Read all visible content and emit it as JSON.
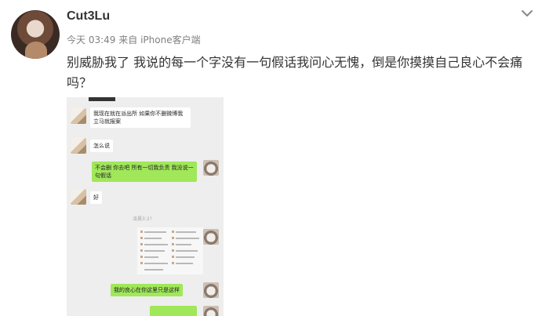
{
  "post": {
    "username": "Cut3Lu",
    "time": "今天 03:49",
    "source_prefix": "来自",
    "source": "iPhone客户端",
    "text": "别威胁我了 我说的每一个字没有一句假话我问心无愧，倒是你摸摸自己良心不会痛吗？",
    "menu_icon": "chevron-down-icon"
  },
  "chat_screenshot": {
    "messages": [
      {
        "side": "left",
        "text": "我现在就在派出所 如果你不删微博我立马就报案"
      },
      {
        "side": "left",
        "text": "怎么说"
      },
      {
        "side": "right",
        "text": "不会删 你去吧 所有一切我负责 我没说一句假话"
      },
      {
        "side": "left",
        "text": "好"
      },
      {
        "side": "right",
        "text": "我的良心在你这里只是这样"
      }
    ],
    "system_note": "凌晨3:2?",
    "colors": {
      "background": "#eeeeee",
      "incoming": "#ffffff",
      "outgoing": "#a0e75a"
    }
  }
}
